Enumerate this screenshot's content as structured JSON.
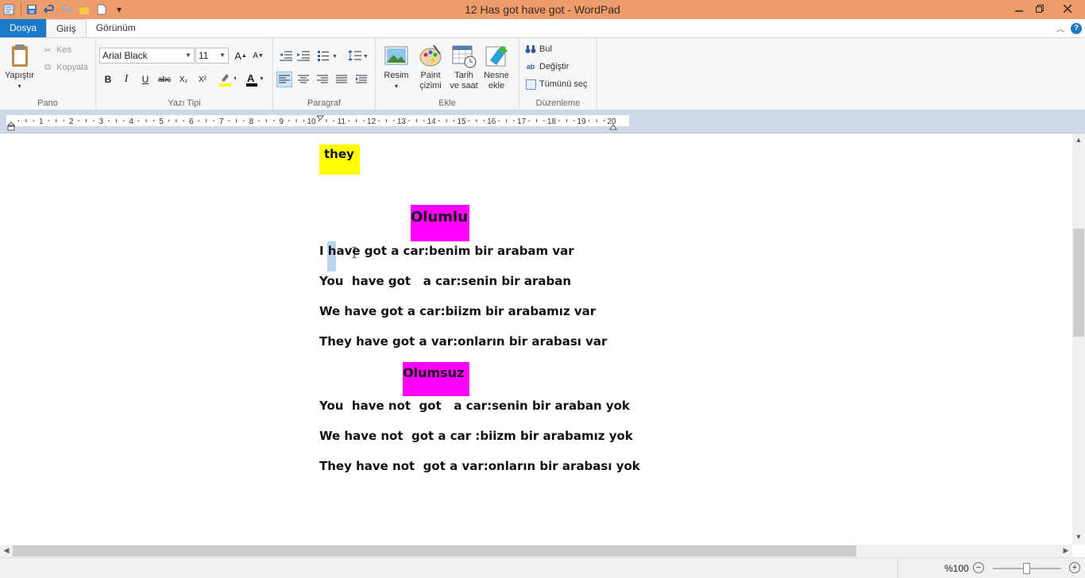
{
  "window": {
    "title": "12 Has got have got - WordPad"
  },
  "tabs": [
    {
      "label": "Dosya"
    },
    {
      "label": "Giriş"
    },
    {
      "label": "Görünüm"
    }
  ],
  "ribbon": {
    "clipboard": {
      "group_label": "Pano",
      "paste_label": "Yapıştır",
      "cut_label": "Kes",
      "copy_label": "Kopyala"
    },
    "font": {
      "group_label": "Yazı Tipi",
      "font_family": "Arial Black",
      "font_size": "11",
      "bold": "B",
      "italic": "I",
      "underline": "U",
      "strike": "abc",
      "subscript": "X₂",
      "superscript": "X²",
      "grow": "A",
      "shrink": "A",
      "highlight_color": "#ffff00",
      "text_color": "#000000"
    },
    "paragraph": {
      "group_label": "Paragraf"
    },
    "insert": {
      "group_label": "Ekle",
      "picture_label_1": "Resim",
      "paint_label_1": "Paint",
      "paint_label_2": "çizimi",
      "datetime_label_1": "Tarih",
      "datetime_label_2": "ve saat",
      "object_label_1": "Nesne",
      "object_label_2": "ekle"
    },
    "editing": {
      "group_label": "Düzenleme",
      "find_label": "Bul",
      "replace_label": "Değiştir",
      "select_all_label": "Tümünü seç"
    }
  },
  "ruler": {
    "numbers": [
      "1",
      "2",
      "3",
      "4",
      "5",
      "6",
      "7",
      "8",
      "9",
      "10",
      "11",
      "12",
      "13",
      "14",
      "15",
      "16",
      "17",
      "18",
      "19",
      "20"
    ]
  },
  "document": {
    "they_box": "they",
    "heading_positive": "Olumlu",
    "positive_lines": [
      "I have got a car:benim bir arabam var",
      "You  have got   a car:senin bir araban",
      "We have got a car:biizm bir arabamız var",
      "They have got a var:onların bir arabası var"
    ],
    "heading_negative": "Olumsuz",
    "negative_lines": [
      "You  have not  got   a car:senin bir araban yok",
      "We have not  got a car :biizm bir arabamız yok",
      "They have not  got a var:onların bir arabası yok"
    ],
    "highlight_yellow": "#ffff00",
    "highlight_magenta": "#ff00ff"
  },
  "status": {
    "zoom": "%100",
    "zoom_minus": "−",
    "zoom_plus": "+"
  }
}
